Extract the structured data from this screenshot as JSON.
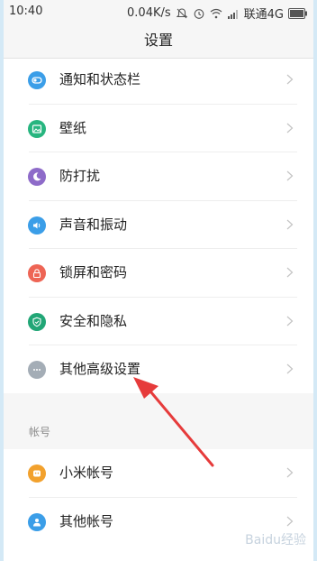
{
  "status": {
    "time": "10:40",
    "speed": "0.04K/s",
    "carrier": "联通4G"
  },
  "header": {
    "title": "设置"
  },
  "settings": [
    {
      "label": "通知和状态栏",
      "icon": "notification-icon",
      "color": "#3b9ee8"
    },
    {
      "label": "壁纸",
      "icon": "wallpaper-icon",
      "color": "#27b57f"
    },
    {
      "label": "防打扰",
      "icon": "moon-icon",
      "color": "#8e6bc9"
    },
    {
      "label": "声音和振动",
      "icon": "speaker-icon",
      "color": "#3b9ee8"
    },
    {
      "label": "锁屏和密码",
      "icon": "lock-icon",
      "color": "#ee6555"
    },
    {
      "label": "安全和隐私",
      "icon": "shield-icon",
      "color": "#21a676"
    },
    {
      "label": "其他高级设置",
      "icon": "more-icon",
      "color": "#a4adb6"
    }
  ],
  "accounts": {
    "section_label": "帐号",
    "items": [
      {
        "label": "小米帐号",
        "icon": "mi-account-icon",
        "color": "#f2a12d"
      },
      {
        "label": "其他帐号",
        "icon": "person-icon",
        "color": "#3b9ee8"
      }
    ]
  },
  "annotation": {
    "color": "#e63b3b"
  },
  "watermark": "Baidu经验"
}
